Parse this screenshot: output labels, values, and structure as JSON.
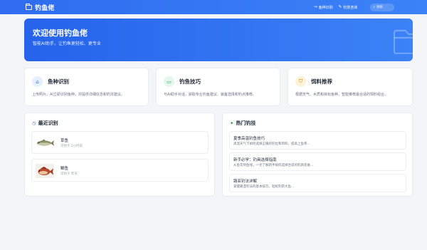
{
  "topbar": {
    "brand": "钓鱼佬",
    "nav": [
      {
        "label": "鱼种识别",
        "icon": "fish-icon"
      },
      {
        "label": "钓技咨询",
        "icon": "pen-icon"
      }
    ],
    "search_label": "搜索"
  },
  "hero": {
    "title": "欢迎使用钓鱼佬",
    "subtitle": "智能AI助手，让钓鱼更轻松、更专业"
  },
  "features": [
    {
      "title": "鱼种识别",
      "desc": "上传照片，AI立即识别鱼种，并提供详细信息和钓法建议。",
      "icon": "home-icon",
      "color": "#2f6cf0",
      "bg": "#e6efff"
    },
    {
      "title": "钓鱼技巧",
      "desc": "与AI助手对话，获取专业钓鱼建议、装备选择和钓点推荐。",
      "icon": "chat-icon",
      "color": "#16a34a",
      "bg": "#e3f7ea"
    },
    {
      "title": "饵料推荐",
      "desc": "根据天气、水质和目标鱼种，智能推荐最合适的饵料组合。",
      "icon": "shield-icon",
      "color": "#d97706",
      "bg": "#fdf3d7"
    }
  ],
  "recent": {
    "title": "最近识别",
    "icon": "clock-icon",
    "items": [
      {
        "name": "草鱼",
        "time": "识别于 2小时前"
      },
      {
        "name": "鲫鱼",
        "time": "识别于 昨天"
      }
    ]
  },
  "tips": {
    "title": "热门钓技",
    "icon": "sparkle-icon",
    "items": [
      {
        "title": "夏季高温钓鱼技巧",
        "desc": "高温天气下如何选择正确的钓位和饵料，提高上鱼率..."
      },
      {
        "title": "新手必学：钓具选择指南",
        "desc": "从鱼竿到鱼线，一文了解新手如何选择合适的钓具装备..."
      },
      {
        "title": "路亚钓法详解",
        "desc": "掌握路亚钓法的基本技巧，轻松钓获大鱼..."
      }
    ]
  },
  "colors": {
    "primary": "#2f6cf0",
    "feature_green": "#16a34a",
    "feature_orange": "#d97706"
  }
}
